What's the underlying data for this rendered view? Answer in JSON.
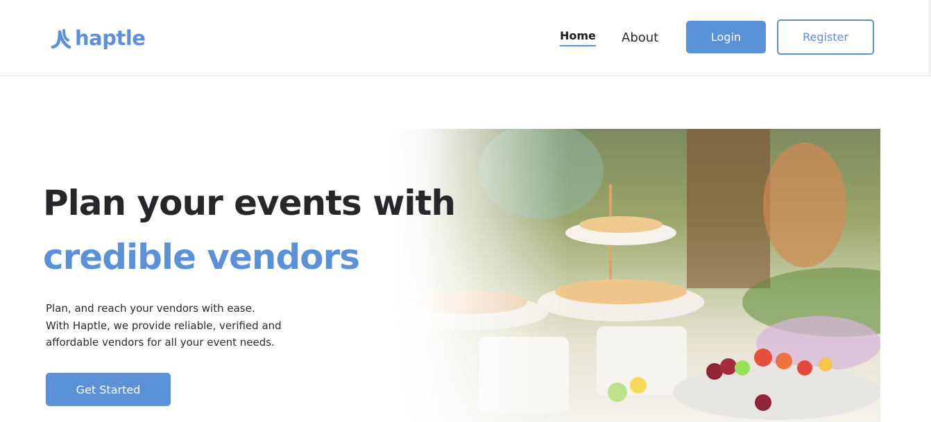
{
  "brand": {
    "name": "haptle",
    "logo_icon": "haptle-logo-icon",
    "color": "#5b91d6"
  },
  "nav": {
    "home": "Home",
    "about": "About",
    "login": "Login",
    "register": "Register"
  },
  "hero": {
    "title_line1": "Plan your events with",
    "title_line2": "credible vendors",
    "description": [
      "Plan, and reach your vendors with ease.",
      "With Haptle, we provide reliable, verified and",
      "affordable vendors for all your event needs."
    ],
    "cta": "Get Started",
    "image": "event-catering-photo"
  }
}
